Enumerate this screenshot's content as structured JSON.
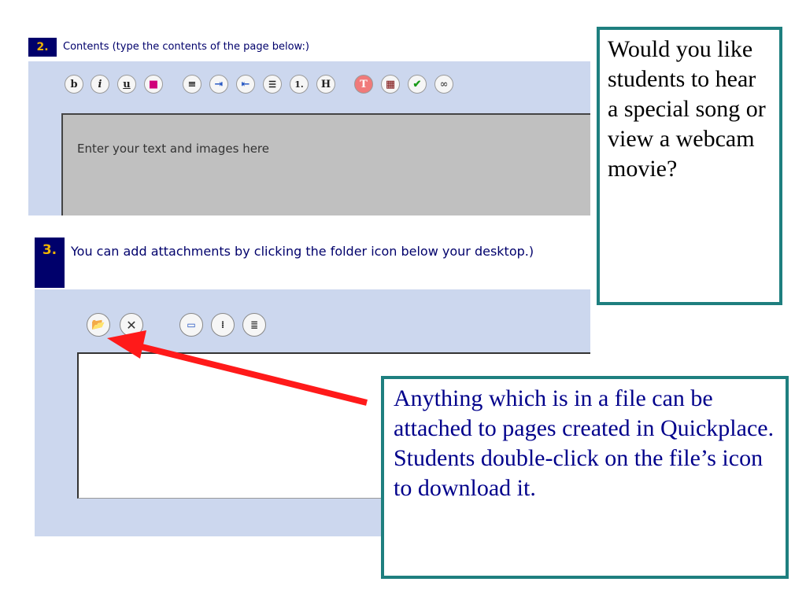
{
  "section2": {
    "number": "2.",
    "label": "Contents (type the contents of the page below:)",
    "toolbar": [
      {
        "icon": "bold-icon",
        "glyph": "b"
      },
      {
        "icon": "italic-icon",
        "glyph": "i"
      },
      {
        "icon": "underline-icon",
        "glyph": "u"
      },
      {
        "icon": "text-color-icon",
        "glyph": "■"
      },
      {
        "icon": "align-center-icon",
        "glyph": "≡"
      },
      {
        "icon": "indent-icon",
        "glyph": "⇥"
      },
      {
        "icon": "outdent-icon",
        "glyph": "⇤"
      },
      {
        "icon": "bulleted-list-icon",
        "glyph": "☰"
      },
      {
        "icon": "numbered-list-icon",
        "glyph": "1."
      },
      {
        "icon": "heading-icon",
        "glyph": "H"
      },
      {
        "icon": "text-style-icon",
        "glyph": "T"
      },
      {
        "icon": "table-icon",
        "glyph": "▦"
      },
      {
        "icon": "spell-check-icon",
        "glyph": "✔"
      },
      {
        "icon": "link-icon",
        "glyph": "∞"
      }
    ],
    "editor_placeholder": "Enter your text and images here"
  },
  "section3": {
    "number": "3.",
    "label": "You can add attachments by clicking the folder icon below your desktop.)",
    "toolbar": [
      {
        "icon": "open-folder-icon",
        "glyph": "📂"
      },
      {
        "icon": "delete-icon",
        "glyph": "✕"
      },
      {
        "icon": "file-icon",
        "glyph": "▭"
      },
      {
        "icon": "list-view-icon",
        "glyph": "⁞"
      },
      {
        "icon": "details-view-icon",
        "glyph": "≣"
      }
    ]
  },
  "callouts": {
    "webcam": "Would you like students to hear a special song or view a webcam movie?",
    "attachments": "Anything which is in a file can be attached to pages created in Quickplace. Students double-click on the file’s icon to download it."
  },
  "colors": {
    "panel_bg": "#ccd7ee",
    "section_number_bg": "#00006b",
    "section_number_text": "#f0b400",
    "callout_border": "#1e7f7f",
    "arrow": "#ff1a1a"
  }
}
